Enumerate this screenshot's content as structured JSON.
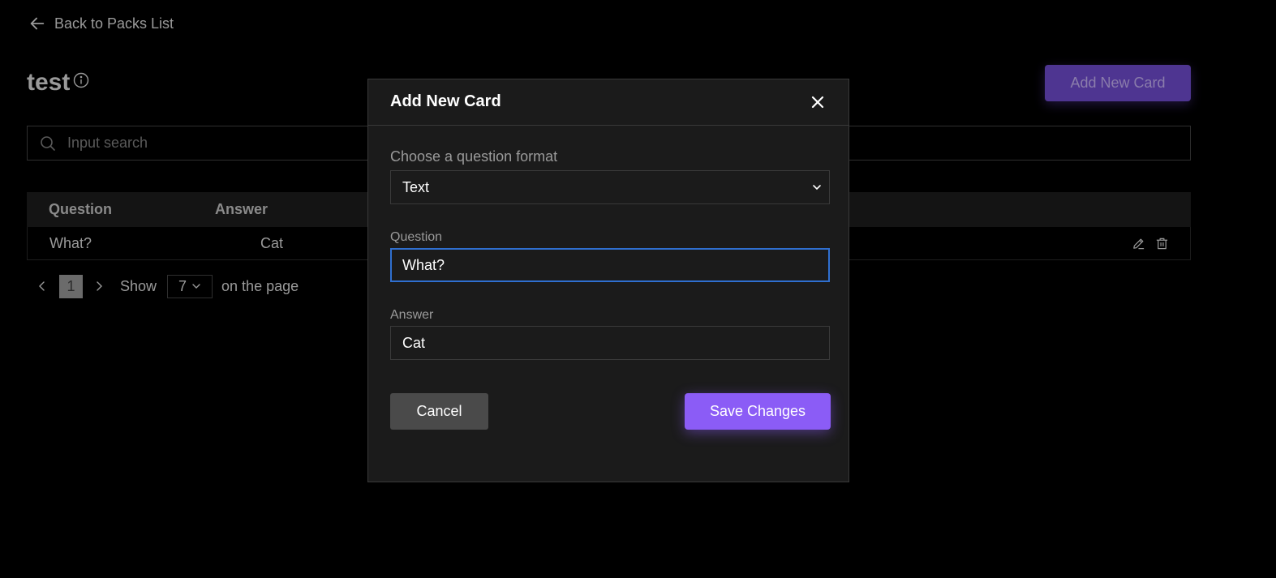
{
  "nav": {
    "back_label": "Back to Packs List"
  },
  "pack": {
    "title": "test"
  },
  "header": {
    "add_card_label": "Add New Card"
  },
  "search": {
    "placeholder": "Input search"
  },
  "table": {
    "columns": [
      "Question",
      "Answer"
    ],
    "rows": [
      {
        "question": "What?",
        "answer": "Cat"
      }
    ]
  },
  "pagination": {
    "current_page": "1",
    "show_label": "Show",
    "page_size": "7",
    "suffix_label": "on the page"
  },
  "modal": {
    "title": "Add New Card",
    "format_label": "Choose a question format",
    "format_value": "Text",
    "question_label": "Question",
    "question_value": "What?",
    "answer_label": "Answer",
    "answer_value": "Cat",
    "cancel_label": "Cancel",
    "save_label": "Save Changes"
  },
  "colors": {
    "background": "#000000",
    "modal_bg": "#1b1b1b",
    "accent": "#8b5cf6",
    "accent_dim": "#4e3591",
    "focus_border": "#2f6fd0"
  }
}
